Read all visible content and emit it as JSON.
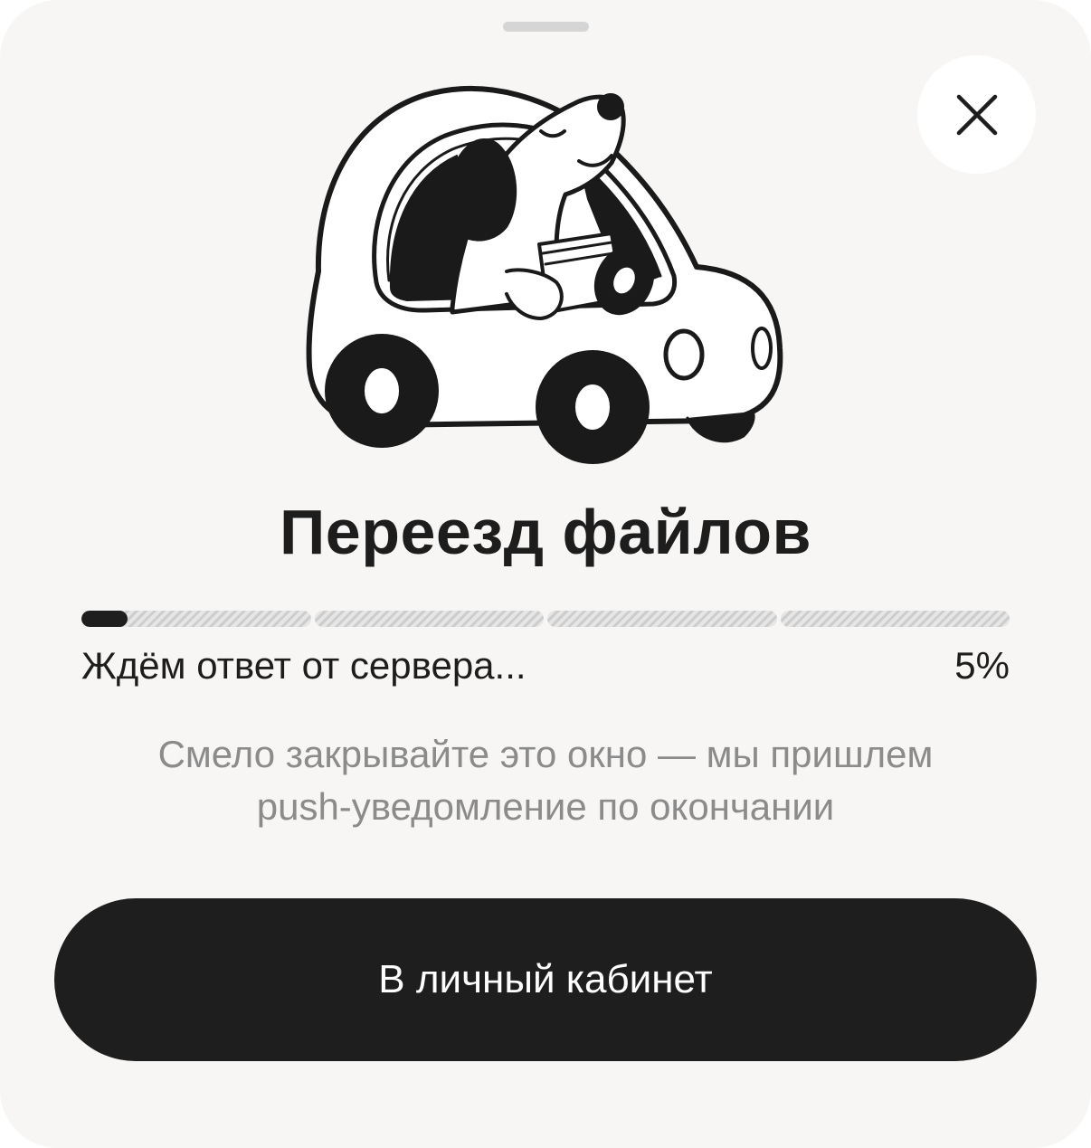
{
  "sheet": {
    "close_icon": "close-icon",
    "illustration": "dog-driving-car-illustration"
  },
  "title": "Переезд файлов",
  "progress": {
    "value_percent": 5,
    "segments": 4,
    "status_text": "Ждём ответ от сервера...",
    "percent_label": "5%"
  },
  "hint": {
    "line1": "Смело закрывайте это окно — мы пришлем",
    "line2": "push-уведомление по окончании"
  },
  "primary_button": {
    "label": "В личный кабинет"
  },
  "colors": {
    "background": "#f7f6f4",
    "primary": "#1e1e1e",
    "muted_text": "#8b8b8b",
    "track": "#dcdcdc"
  }
}
